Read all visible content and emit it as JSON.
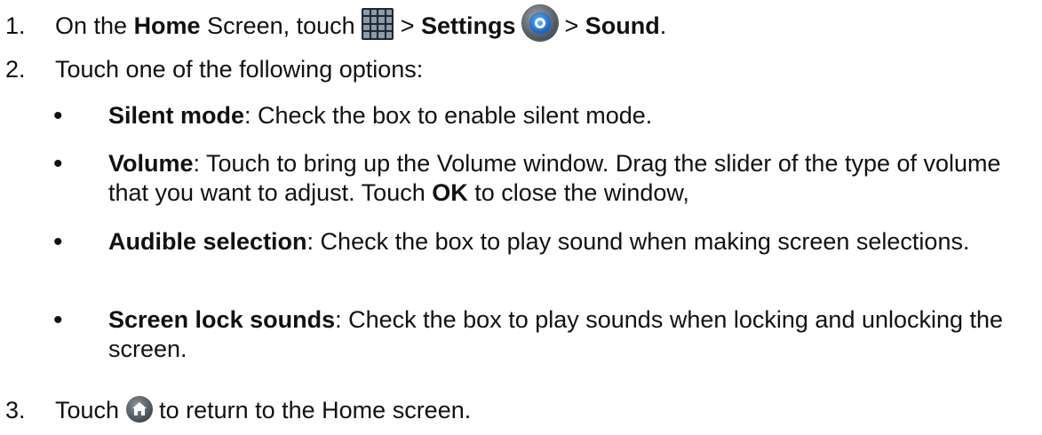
{
  "steps": [
    {
      "num": "1.",
      "parts": {
        "a": "On the ",
        "b": "Home",
        "c": " Screen, touch ",
        "d": " > ",
        "e": "Settings",
        "f": " > ",
        "g": "Sound",
        "h": "."
      },
      "icons": [
        "grid-icon",
        "settings-icon"
      ]
    },
    {
      "num": "2.",
      "text": "Touch one of the following options:"
    },
    {
      "num": "3.",
      "parts": {
        "a": "Touch ",
        "b": " to return to the Home screen."
      },
      "icons": [
        "home-icon"
      ]
    }
  ],
  "bullets": [
    {
      "bullet": "•",
      "term": "Silent mode",
      "text": ": Check the box to enable silent mode."
    },
    {
      "bullet": "•",
      "term": "Volume",
      "text1": ": Touch to bring up the Volume window. Drag the slider of the type of volume that you want to adjust. Touch ",
      "ok": "OK",
      "text2": " to close the window,"
    },
    {
      "bullet": "•",
      "term": "Audible selection",
      "text": ": Check the box to play sound when making screen selections."
    },
    {
      "bullet": "•",
      "term": "Screen lock sounds",
      "text": ": Check the box to play sounds when locking and unlocking the screen."
    }
  ]
}
